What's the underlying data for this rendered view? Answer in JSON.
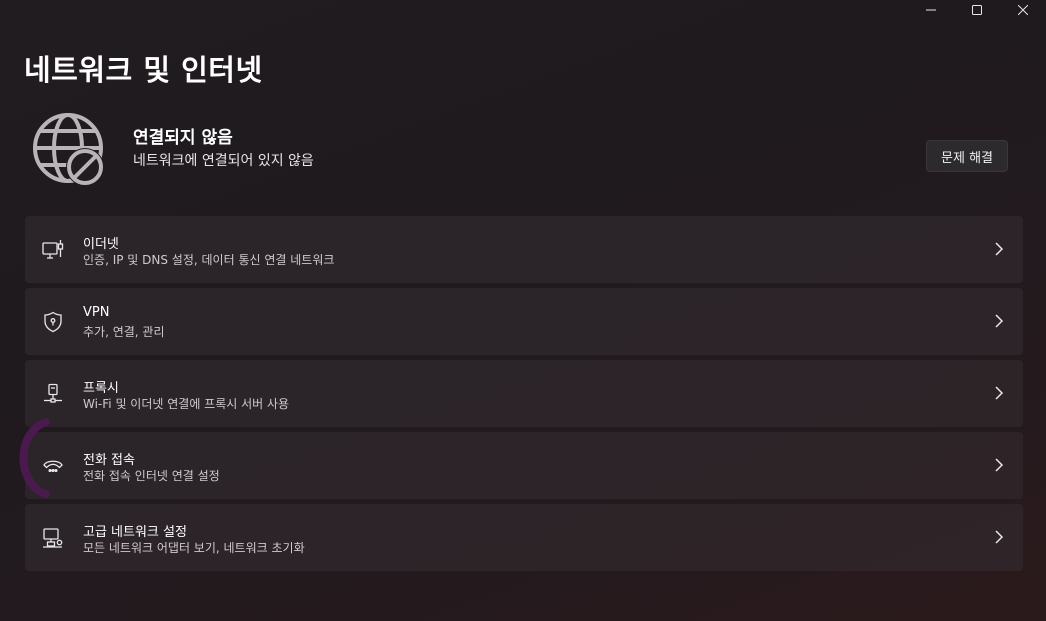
{
  "window": {
    "controls": {
      "minimize": "—",
      "maximize": "□",
      "close": "✕"
    }
  },
  "page": {
    "title": "네트워크 및 인터넷"
  },
  "status": {
    "icon": "globe-blocked-icon",
    "title": "연결되지 않음",
    "subtitle": "네트워크에 연결되어 있지 않음",
    "troubleshoot_label": "문제 해결"
  },
  "items": [
    {
      "icon": "ethernet-icon",
      "title": "이더넷",
      "subtitle": "인증, IP 및 DNS 설정, 데이터 통신 연결 네트워크"
    },
    {
      "icon": "vpn-shield-icon",
      "title": "VPN",
      "subtitle": "추가, 연결, 관리"
    },
    {
      "icon": "proxy-icon",
      "title": "프록시",
      "subtitle": "Wi-Fi 및 이더넷 연결에 프록시 서버 사용"
    },
    {
      "icon": "dial-up-icon",
      "title": "전화 접속",
      "subtitle": "전화 접속 인터넷 연결 설정"
    },
    {
      "icon": "advanced-network-icon",
      "title": "고급 네트워크 설정",
      "subtitle": "모든 네트워크 어댑터 보기, 네트워크 초기화"
    }
  ],
  "colors": {
    "background": "#201c20",
    "card": "#2e292c",
    "accent": "#4a1a4e"
  }
}
